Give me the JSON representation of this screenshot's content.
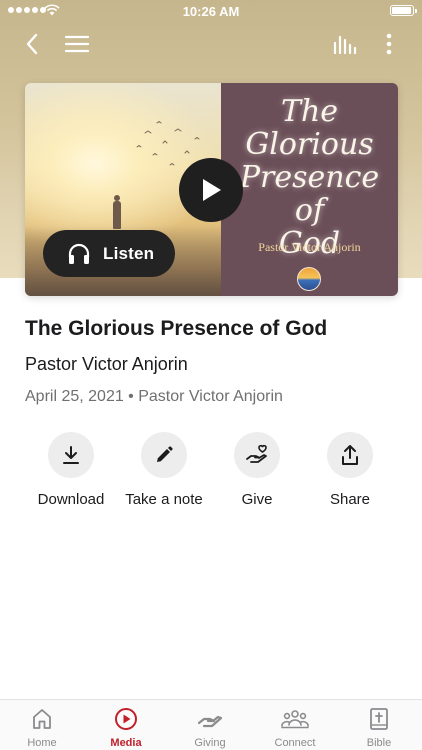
{
  "status_bar": {
    "time": "10:26 AM"
  },
  "nav": {
    "back_icon": "chevron-left-icon",
    "menu_icon": "hamburger-icon",
    "audio_icon": "equalizer-icon",
    "more_icon": "more-vertical-icon"
  },
  "artwork": {
    "title_line1": "The",
    "title_line2": "Glorious",
    "title_line3": "Presence of",
    "title_line4": "God",
    "subtitle": "Pastor Victor Anjorin"
  },
  "player": {
    "listen_label": "Listen",
    "play_icon": "play-icon",
    "headphones_icon": "headphones-icon"
  },
  "sermon": {
    "title": "The Glorious Presence of God",
    "speaker": "Pastor Victor Anjorin",
    "meta": "April 25, 2021 • Pastor Victor Anjorin"
  },
  "actions": [
    {
      "label": "Download",
      "icon": "download-icon"
    },
    {
      "label": "Take a note",
      "icon": "pencil-icon"
    },
    {
      "label": "Give",
      "icon": "give-icon"
    },
    {
      "label": "Share",
      "icon": "share-icon"
    }
  ],
  "tabs": [
    {
      "label": "Home",
      "icon": "home-icon",
      "active": false
    },
    {
      "label": "Media",
      "icon": "play-circle-icon",
      "active": true
    },
    {
      "label": "Giving",
      "icon": "giving-icon",
      "active": false
    },
    {
      "label": "Connect",
      "icon": "people-icon",
      "active": false
    },
    {
      "label": "Bible",
      "icon": "bible-icon",
      "active": false
    }
  ],
  "colors": {
    "accent": "#c0202b",
    "tab_inactive": "#8b8b8e",
    "action_circle": "#ededee",
    "hero_bg": "#d4c49c"
  }
}
